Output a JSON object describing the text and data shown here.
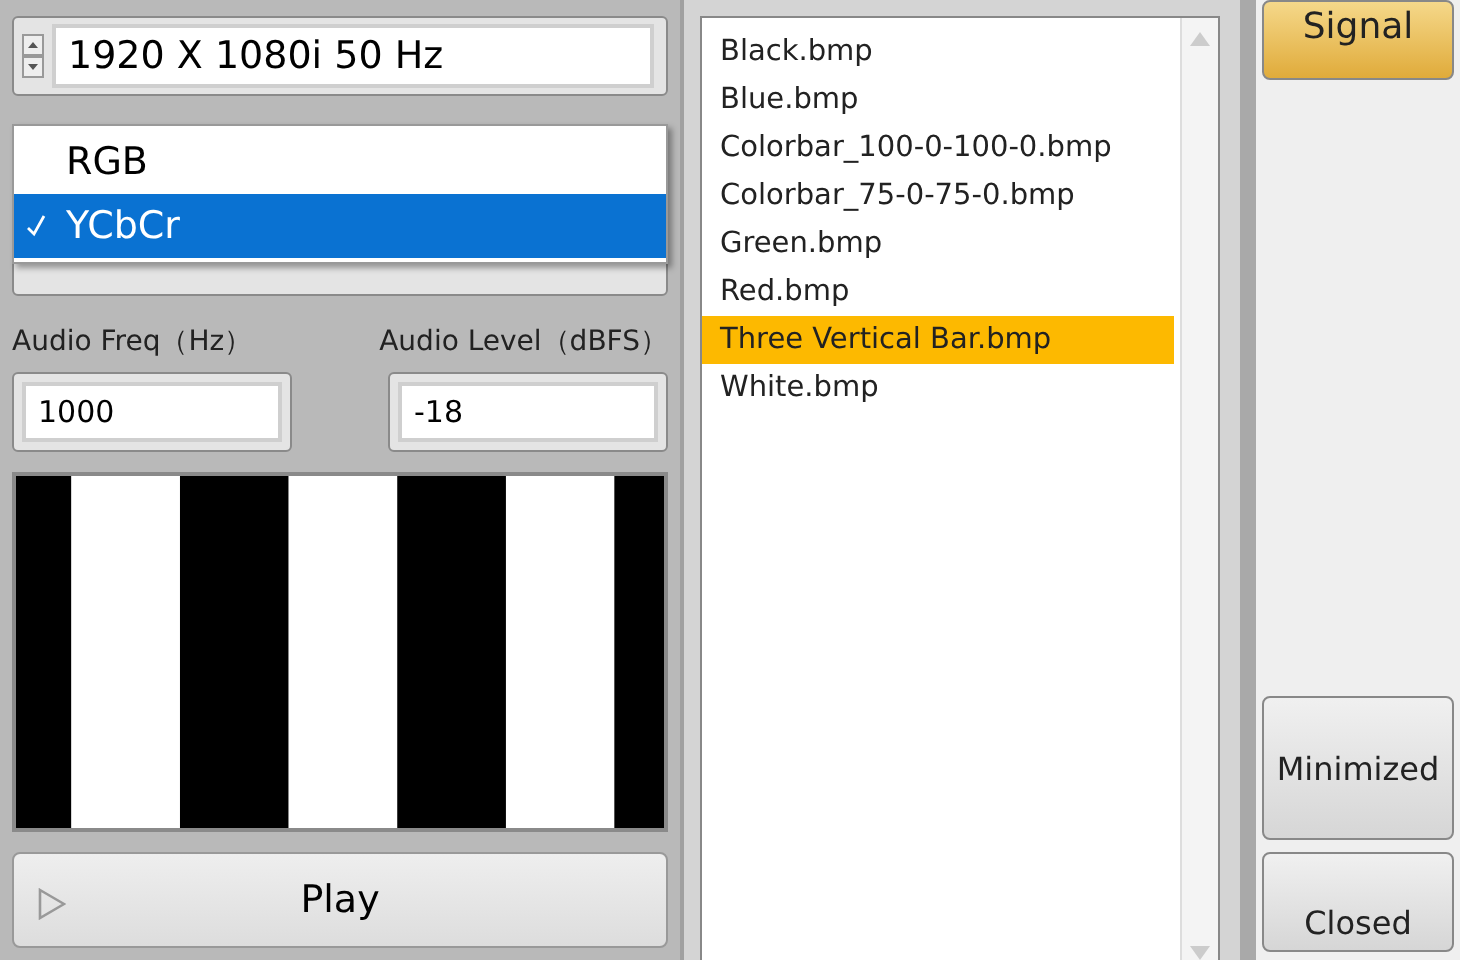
{
  "format_selector": {
    "value": "1920 X 1080i 50 Hz"
  },
  "color_menu": {
    "options": [
      {
        "label": "RGB",
        "selected": false
      },
      {
        "label": "YCbCr",
        "selected": true
      }
    ]
  },
  "audio_freq": {
    "label": "Audio Freq（Hz）",
    "value": "1000"
  },
  "audio_level": {
    "label": "Audio Level（dBFS）",
    "value": "-18"
  },
  "play_button": {
    "label": "Play"
  },
  "files": [
    {
      "name": "Black.bmp",
      "selected": false
    },
    {
      "name": "Blue.bmp",
      "selected": false
    },
    {
      "name": "Colorbar_100-0-100-0.bmp",
      "selected": false
    },
    {
      "name": "Colorbar_75-0-75-0.bmp",
      "selected": false
    },
    {
      "name": "Green.bmp",
      "selected": false
    },
    {
      "name": "Red.bmp",
      "selected": false
    },
    {
      "name": "Three Vertical Bar.bmp",
      "selected": true
    },
    {
      "name": "White.bmp",
      "selected": false
    }
  ],
  "side_buttons": [
    {
      "label": "Signal",
      "kind": "accent"
    },
    {
      "label": "Minimized",
      "kind": "plain"
    },
    {
      "label": "Closed",
      "kind": "plain"
    }
  ]
}
